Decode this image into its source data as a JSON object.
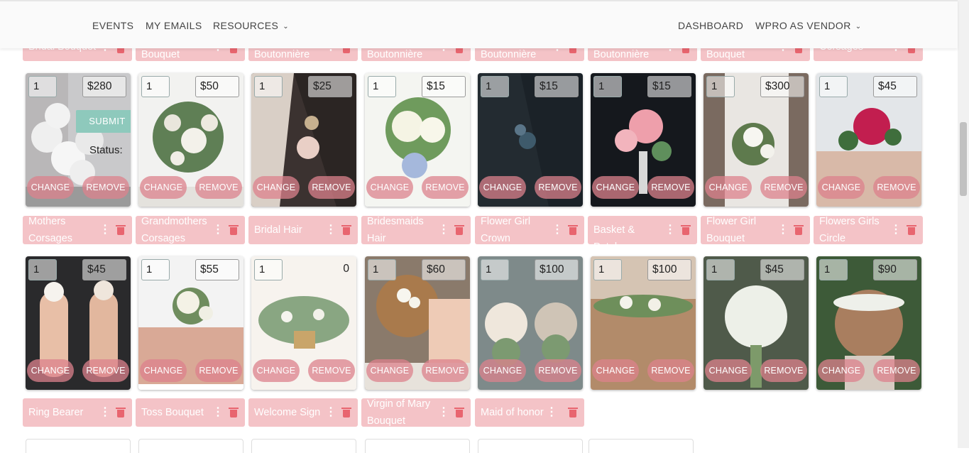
{
  "nav": {
    "events": "EVENTS",
    "my_emails": "MY EMAILS",
    "resources": "RESOURCES",
    "dashboard": "DASHBOARD",
    "wpro_vendor": "WPRO AS VENDOR"
  },
  "top_labels": [
    "Bridal Bouquet",
    "Bouquet",
    "Boutonnière",
    "Boutonnière",
    "Boutonnière",
    "Boutonnière",
    "Bouquet",
    "Corsages"
  ],
  "row1": {
    "cards": [
      {
        "qty": "1",
        "price": "$280",
        "change": "CHANGE",
        "remove": "REMOVE"
      },
      {
        "qty": "1",
        "price": "$50",
        "change": "CHANGE",
        "remove": "REMOVE"
      },
      {
        "qty": "1",
        "price": "$25",
        "change": "CHANGE",
        "remove": "REMOVE"
      },
      {
        "qty": "1",
        "price": "$15",
        "change": "CHANGE",
        "remove": "REMOVE"
      },
      {
        "qty": "1",
        "price": "$15",
        "change": "CHANGE",
        "remove": "REMOVE"
      },
      {
        "qty": "1",
        "price": "$15",
        "change": "CHANGE",
        "remove": "REMOVE"
      },
      {
        "qty": "1",
        "price": "$300",
        "change": "CHANGE",
        "remove": "REMOVE"
      },
      {
        "qty": "1",
        "price": "$45",
        "change": "CHANGE",
        "remove": "REMOVE"
      }
    ],
    "submit": "SUBMIT",
    "status": "Status:",
    "labels": [
      "Mothers Corsages",
      "Grandmothers Corsages",
      "Bridal Hair",
      "Bridesmaids Hair",
      "Flower Girl Crown",
      "Flower Girl Basket & Petals",
      "Flower Girl Bouquet",
      "Flowers Girls Circle"
    ]
  },
  "row2": {
    "cards": [
      {
        "qty": "1",
        "price": "$45",
        "change": "CHANGE",
        "remove": "REMOVE"
      },
      {
        "qty": "1",
        "price": "$55",
        "change": "CHANGE",
        "remove": "REMOVE"
      },
      {
        "qty": "1",
        "price": "0",
        "change": "CHANGE",
        "remove": "REMOVE"
      },
      {
        "qty": "1",
        "price": "$60",
        "change": "CHANGE",
        "remove": "REMOVE"
      },
      {
        "qty": "1",
        "price": "$100",
        "change": "CHANGE",
        "remove": "REMOVE"
      },
      {
        "qty": "1",
        "price": "$100",
        "change": "CHANGE",
        "remove": "REMOVE"
      },
      {
        "qty": "1",
        "price": "$45",
        "change": "CHANGE",
        "remove": "REMOVE"
      },
      {
        "qty": "1",
        "price": "$90",
        "change": "CHANGE",
        "remove": "REMOVE"
      }
    ],
    "labels": [
      "Ring Bearer",
      "Toss Bouquet",
      "Welcome Sign",
      "Virgin of Mary Bouquet",
      "Maid of honor"
    ]
  }
}
